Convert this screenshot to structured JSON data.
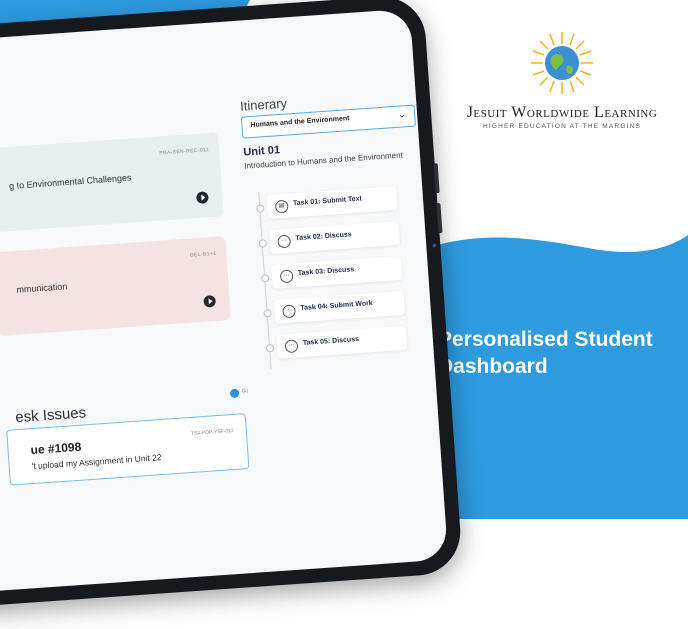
{
  "brand": {
    "name": "Jesuit Worldwide Learning",
    "tagline": "HIGHER EDUCATION AT THE MARGINS"
  },
  "headline": "Personalised Student Dashboard",
  "colors": {
    "accent_blue": "#2e9be0",
    "card_teal": "#e7eef0",
    "card_pink": "#f5e3e4"
  },
  "courses": [
    {
      "code": "PBA-SEN-REC-011",
      "title": "g to Environmental Challenges"
    },
    {
      "code": "GEL-B1+1",
      "title": "mmunication"
    }
  ],
  "issues": {
    "heading": "esk Issues",
    "count": "(1)",
    "items": [
      {
        "number": "ue #1098",
        "code": "TS4-POP-YSF-012",
        "description": "'t upload my Assignment in Unit 22"
      }
    ]
  },
  "itinerary": {
    "title": "Itinerary",
    "selected_course": "Humans and the Environment",
    "unit": "Unit 01",
    "unit_description": "Introduction to Humans and the Environment",
    "tasks": [
      {
        "label": "Task 01: Submit Text",
        "icon": "submit-text-icon"
      },
      {
        "label": "Task 02: Discuss",
        "icon": "discuss-icon"
      },
      {
        "label": "Task 03: Discuss",
        "icon": "discuss-icon"
      },
      {
        "label": "Task 04:  Submit Work",
        "icon": "upload-icon"
      },
      {
        "label": "Task 05: Discuss",
        "icon": "discuss-icon"
      }
    ]
  }
}
